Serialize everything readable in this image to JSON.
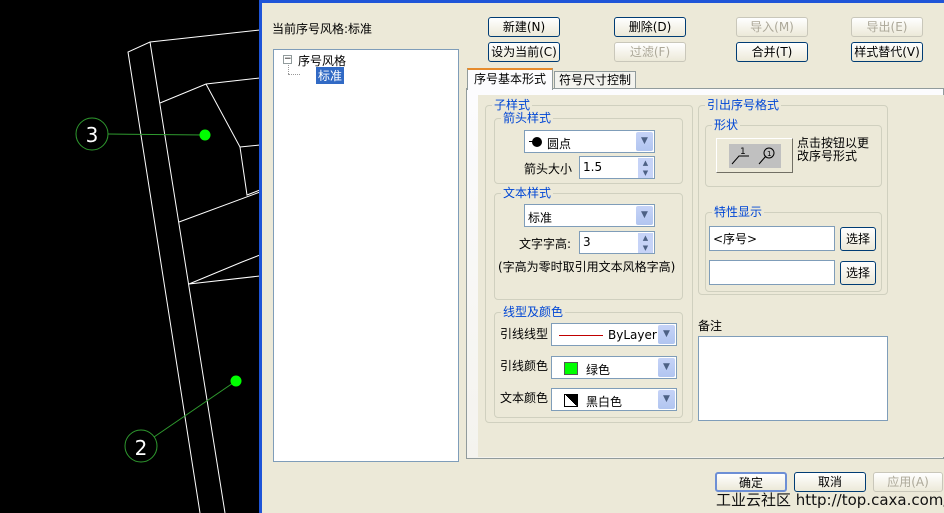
{
  "cad": {
    "balloons": [
      "3",
      "2"
    ]
  },
  "dialog": {
    "current_style_label": "当前序号风格:标准",
    "tree": {
      "root": "序号风格",
      "child": "标准"
    },
    "buttons": {
      "new": "新建(N)",
      "delete": "删除(D)",
      "import": "导入(M)",
      "export": "导出(E)",
      "set_current": "设为当前(C)",
      "filter": "过滤(F)",
      "merge": "合并(T)",
      "replace": "样式替代(V)"
    },
    "tabs": [
      "序号基本形式",
      "符号尺寸控制"
    ],
    "sub_style": {
      "title": "子样式",
      "arrow": {
        "title": "箭头样式",
        "style": "圆点",
        "size_label": "箭头大小",
        "size": "1.5"
      },
      "text": {
        "title": "文本样式",
        "style": "标准",
        "height_label": "文字字高:",
        "height": "3",
        "note": "(字高为零时取引用文本风格字高)"
      },
      "line": {
        "title": "线型及颜色",
        "linetype_label": "引线线型",
        "linetype": "ByLayer",
        "linecolor_label": "引线颜色",
        "linecolor": "绿色",
        "textcolor_label": "文本颜色",
        "textcolor": "黑白色"
      }
    },
    "format": {
      "title": "引出序号格式",
      "shape_title": "形状",
      "shape_hint": "点击按钮以更改序号形式",
      "prop_title": "特性显示",
      "prop1": "<序号>",
      "prop2": "",
      "select": "选择"
    },
    "remark_label": "备注",
    "ok": "确定",
    "cancel": "取消",
    "apply": "应用(A)"
  },
  "watermark": "工业云社区 http://top.caxa.com/",
  "colors": {
    "green": "#00ff00",
    "accent": "#0046d5"
  }
}
